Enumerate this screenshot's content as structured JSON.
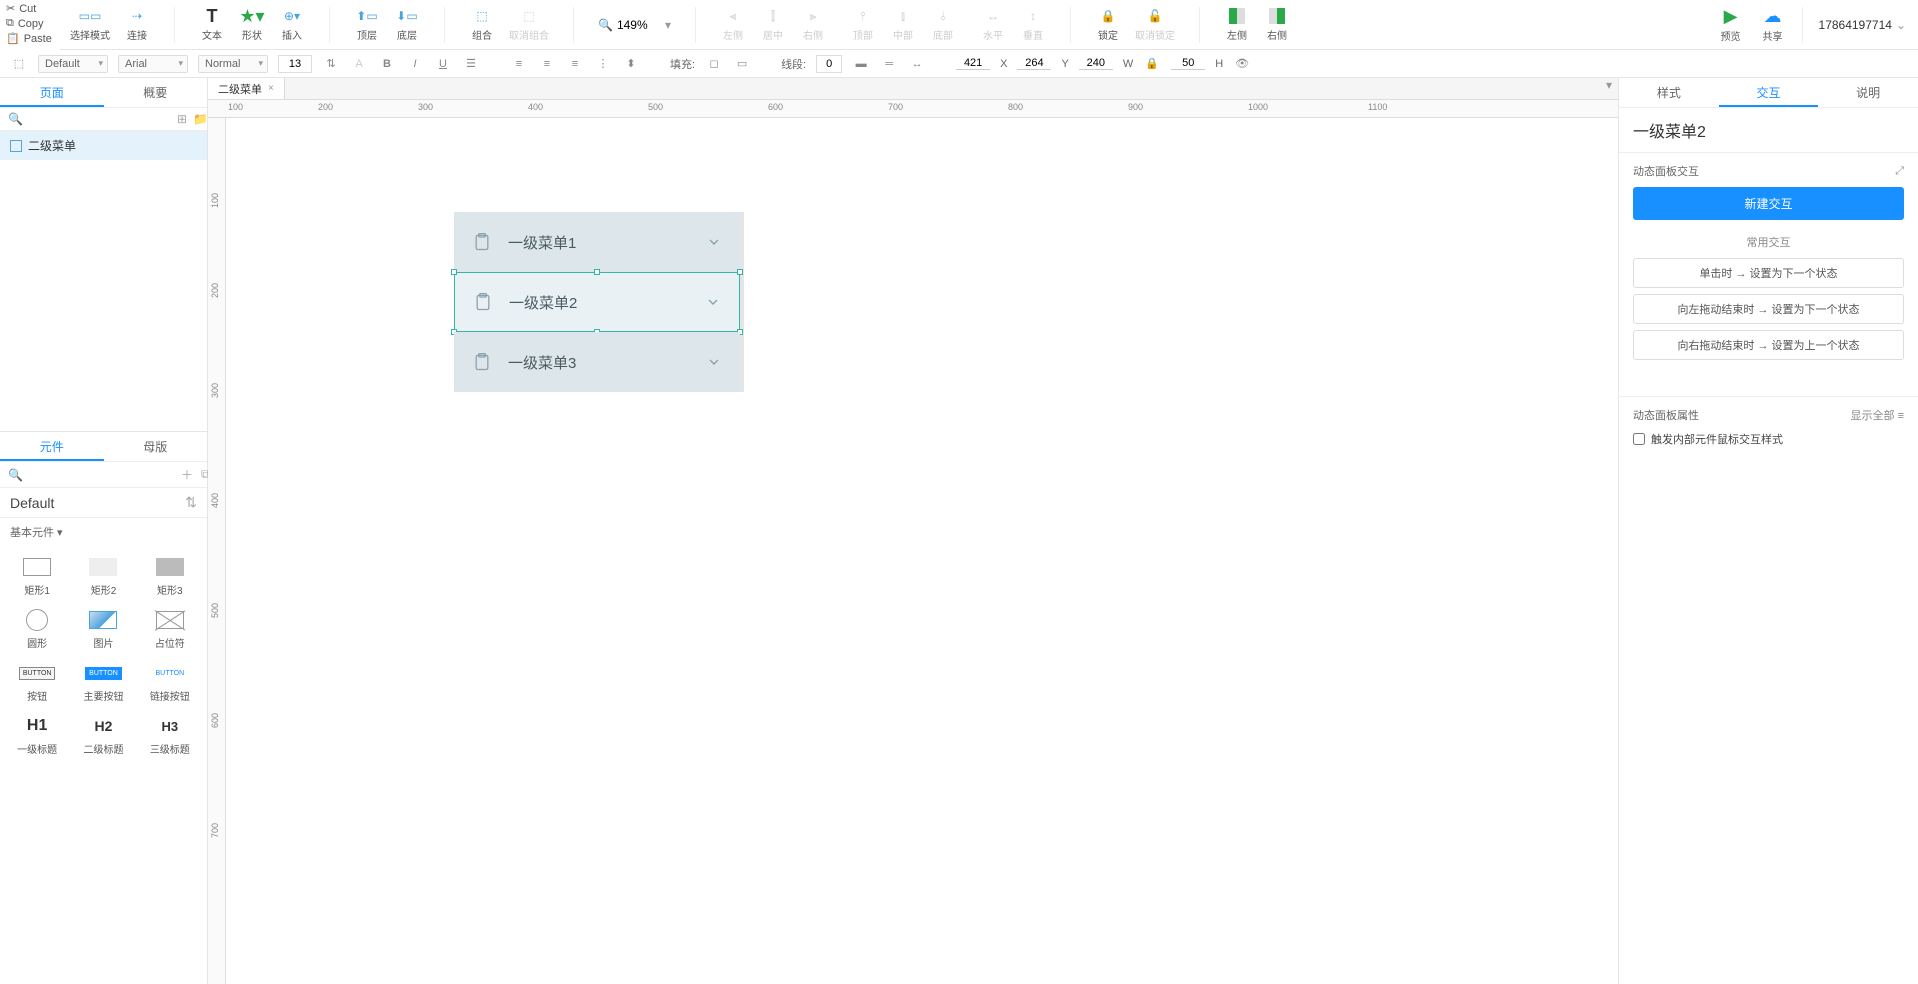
{
  "clipboard": {
    "cut": "Cut",
    "copy": "Copy",
    "paste": "Paste"
  },
  "toolbar": {
    "select_mode": "选择模式",
    "connect": "连接",
    "text": "文本",
    "shape": "形状",
    "insert": "插入",
    "top_layer": "顶层",
    "bottom_layer": "底层",
    "group": "组合",
    "ungroup": "取消组合",
    "zoom": "149%",
    "align_left": "左侧",
    "align_center": "居中",
    "align_right": "右侧",
    "align_top": "顶部",
    "align_middle": "中部",
    "align_bottom": "底部",
    "dist_h": "水平",
    "dist_v": "垂直",
    "lock": "锁定",
    "unlock": "取消锁定",
    "left_align2": "左侧",
    "right_align2": "右侧",
    "preview": "预览",
    "share": "共享"
  },
  "user": {
    "id": "17864197714"
  },
  "format": {
    "preset": "Default",
    "font": "Arial",
    "weight": "Normal",
    "size": "13",
    "fill_label": "填充:",
    "line_label": "线段:",
    "line_val": "0",
    "x": "421",
    "x_lbl": "X",
    "y": "264",
    "y_lbl": "Y",
    "w": "240",
    "w_lbl": "W",
    "h": "50",
    "h_lbl": "H"
  },
  "left": {
    "tab_page": "页面",
    "tab_outline": "概要",
    "page_name": "二级菜单",
    "tab_widgets": "元件",
    "tab_masters": "母版",
    "library": "Default",
    "category": "基本元件 ▾",
    "widgets": [
      "矩形1",
      "矩形2",
      "矩形3",
      "圆形",
      "图片",
      "占位符",
      "按钮",
      "主要按钮",
      "链接按钮",
      "一级标题",
      "二级标题",
      "三级标题"
    ],
    "h_labels": [
      "H1",
      "H2",
      "H3"
    ]
  },
  "canvas": {
    "doc_tab": "二级菜单",
    "menu_items": [
      "一级菜单1",
      "一级菜单2",
      "一级菜单3"
    ],
    "ruler_h": [
      "100",
      "200",
      "300",
      "400",
      "500",
      "600",
      "700",
      "800",
      "900",
      "1000",
      "1100"
    ],
    "ruler_v": [
      "100",
      "200",
      "300",
      "400",
      "500",
      "600",
      "700"
    ]
  },
  "right": {
    "tab_style": "样式",
    "tab_ix": "交互",
    "tab_notes": "说明",
    "sel_name": "一级菜单2",
    "sec_panel_ix": "动态面板交互",
    "btn_new": "新建交互",
    "sec_common": "常用交互",
    "presets": [
      "单击时 → 设置为下一个状态",
      "向左拖动结束时 → 设置为下一个状态",
      "向右拖动结束时 → 设置为上一个状态"
    ],
    "sec_props": "动态面板属性",
    "show_all": "显示全部",
    "chk_inner": "触发内部元件鼠标交互样式"
  }
}
